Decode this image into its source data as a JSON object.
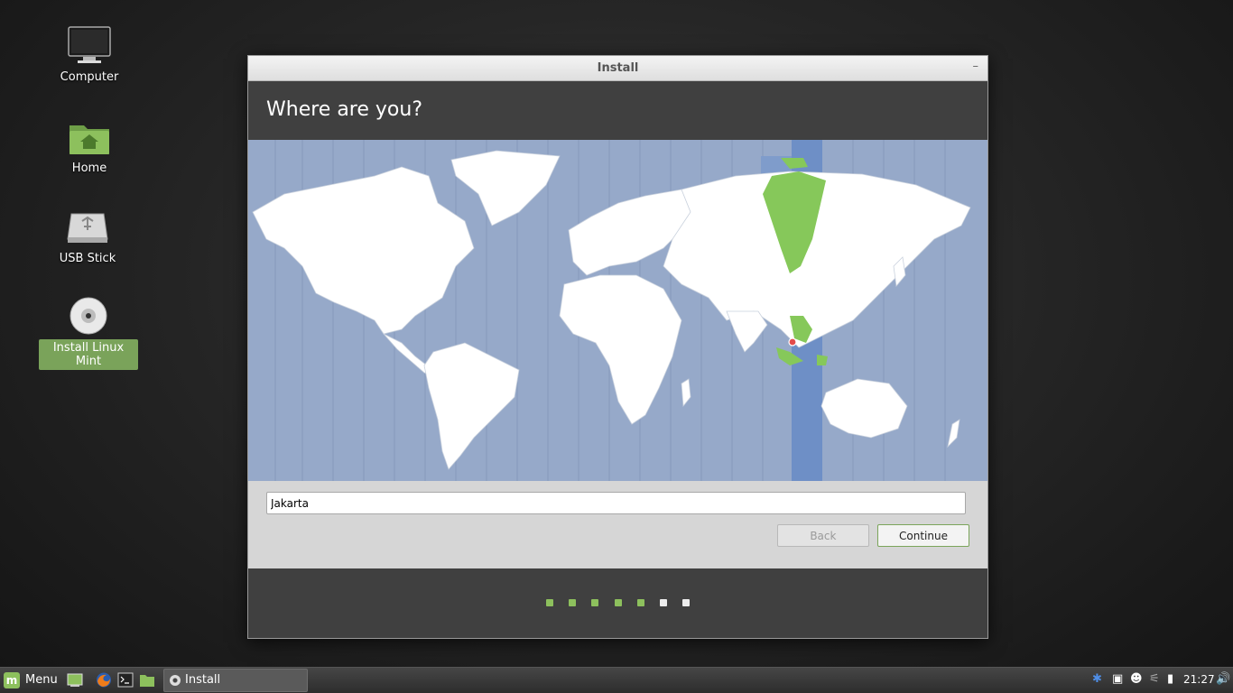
{
  "desktop": {
    "icons": [
      {
        "label": "Computer"
      },
      {
        "label": "Home"
      },
      {
        "label": "USB Stick"
      },
      {
        "label": "Install Linux Mint"
      }
    ]
  },
  "window": {
    "title": "Install",
    "minimize_glyph": "–",
    "heading": "Where are you?",
    "city_value": "Jakarta",
    "back_label": "Back",
    "continue_label": "Continue",
    "progress": {
      "total": 7,
      "completed": 5
    },
    "selected_timezone_marker": "Jakarta"
  },
  "taskbar": {
    "menu_label": "Menu",
    "task_label": "Install",
    "clock": "21:27",
    "tray_icons": [
      "bluetooth-icon",
      "update-manager-icon",
      "user-icon",
      "network-icon",
      "battery-icon",
      "volume-icon"
    ]
  },
  "colors": {
    "accent_green": "#8dc05d",
    "map_ocean": "#96a9c9",
    "timezone_band": "#6e8fc6",
    "header_dark": "#404040"
  }
}
